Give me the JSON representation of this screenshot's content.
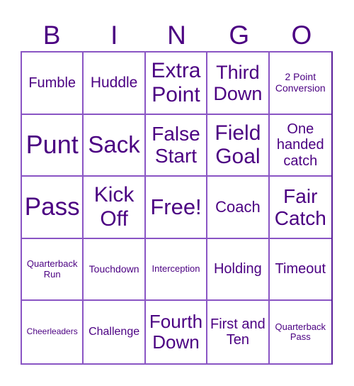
{
  "header": {
    "letters": [
      "B",
      "I",
      "N",
      "G",
      "O"
    ]
  },
  "colors": {
    "text": "#4b0082",
    "lines": "#8a55c4",
    "background": "#ffffff"
  },
  "cells": [
    [
      {
        "text": "Fumble",
        "size": "20"
      },
      {
        "text": "Huddle",
        "size": "21"
      },
      {
        "text": "Extra Point",
        "size": "30"
      },
      {
        "text": "Third Down",
        "size": "27"
      },
      {
        "text": "2 Point Conversion",
        "size": "14"
      }
    ],
    [
      {
        "text": "Punt",
        "size": "36"
      },
      {
        "text": "Sack",
        "size": "33"
      },
      {
        "text": "False Start",
        "size": "28"
      },
      {
        "text": "Field Goal",
        "size": "30"
      },
      {
        "text": "One handed catch",
        "size": "20"
      }
    ],
    [
      {
        "text": "Pass",
        "size": "35"
      },
      {
        "text": "Kick Off",
        "size": "30"
      },
      {
        "text": "Free!",
        "size": "31"
      },
      {
        "text": "Coach",
        "size": "22"
      },
      {
        "text": "Fair Catch",
        "size": "28"
      }
    ],
    [
      {
        "text": "Quarterback Run",
        "size": "13"
      },
      {
        "text": "Touchdown",
        "size": "14"
      },
      {
        "text": "Interception",
        "size": "13"
      },
      {
        "text": "Holding",
        "size": "20"
      },
      {
        "text": "Timeout",
        "size": "20"
      }
    ],
    [
      {
        "text": "Cheerleaders",
        "size": "12"
      },
      {
        "text": "Challenge",
        "size": "16"
      },
      {
        "text": "Fourth Down",
        "size": "26"
      },
      {
        "text": "First and Ten",
        "size": "20"
      },
      {
        "text": "Quarterback Pass",
        "size": "13"
      }
    ]
  ]
}
